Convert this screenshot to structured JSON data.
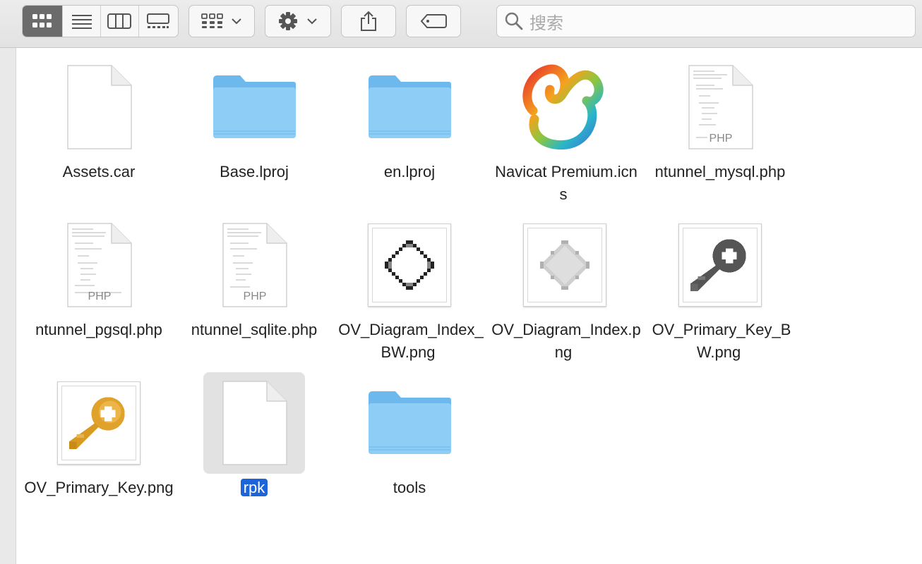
{
  "toolbar": {
    "view_modes": [
      "icon-view",
      "list-view",
      "column-view",
      "gallery-view"
    ],
    "active_view": "icon-view",
    "group_button": "group-icon",
    "action_button": "gear-icon",
    "share_button": "share-icon",
    "tag_button": "tag-icon",
    "search_placeholder": "搜索"
  },
  "files": [
    {
      "name": "Assets.car",
      "type": "document"
    },
    {
      "name": "Base.lproj",
      "type": "folder"
    },
    {
      "name": "en.lproj",
      "type": "folder"
    },
    {
      "name": "Navicat Premium.icns",
      "type": "navicat"
    },
    {
      "name": "ntunnel_mysql.php",
      "type": "php",
      "badge": "PHP"
    },
    {
      "name": "ntunnel_pgsql.php",
      "type": "php",
      "badge": "PHP"
    },
    {
      "name": "ntunnel_sqlite.php",
      "type": "php",
      "badge": "PHP"
    },
    {
      "name": "OV_Diagram_Index_BW.png",
      "type": "img-diamond-bw"
    },
    {
      "name": "OV_Diagram_Index.png",
      "type": "img-diamond-gray"
    },
    {
      "name": "OV_Primary_Key_BW.png",
      "type": "img-key-bw"
    },
    {
      "name": "OV_Primary_Key.png",
      "type": "img-key-gold"
    },
    {
      "name": "rpk",
      "type": "document",
      "selected": true
    },
    {
      "name": "tools",
      "type": "folder"
    }
  ],
  "colors": {
    "folder": "#7cc3f2",
    "selection": "#1c64d8",
    "key_gold": "#e1a22b",
    "key_bw": "#555555"
  }
}
